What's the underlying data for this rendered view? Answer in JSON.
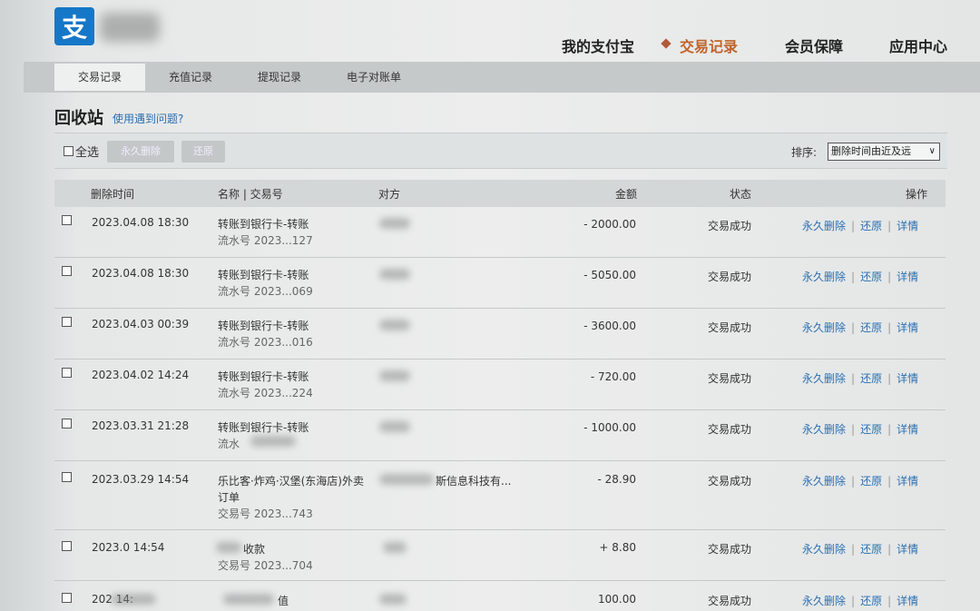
{
  "header": {
    "logo_char": "支",
    "nav": [
      "我的支付宝",
      "交易记录",
      "会员保障",
      "应用中心"
    ]
  },
  "subtabs": [
    "交易记录",
    "充值记录",
    "提现记录",
    "电子对账单"
  ],
  "page": {
    "title": "回收站",
    "help_link": "使用遇到问题?"
  },
  "toolbar": {
    "select_all": "全选",
    "permanent_delete": "永久删除",
    "restore": "还原",
    "sort_label": "排序:",
    "sort_value": "删除时间由近及远"
  },
  "table": {
    "headers": {
      "time": "删除时间",
      "name": "名称 | 交易号",
      "counterparty": "对方",
      "amount": "金额",
      "status": "状态",
      "ops": "操作"
    },
    "ops": [
      "永久删除",
      "还原",
      "详情"
    ],
    "rows": [
      {
        "time": "2023.04.08 18:30",
        "name": "转账到银行卡-转账",
        "name2": "",
        "sub": "流水号 2023...127",
        "party": "",
        "amount": "- 2000.00",
        "status": "交易成功"
      },
      {
        "time": "2023.04.08 18:30",
        "name": "转账到银行卡-转账",
        "name2": "",
        "sub": "流水号 2023...069",
        "party": "",
        "amount": "- 5050.00",
        "status": "交易成功"
      },
      {
        "time": "2023.04.03 00:39",
        "name": "转账到银行卡-转账",
        "name2": "",
        "sub": "流水号 2023...016",
        "party": "",
        "amount": "- 3600.00",
        "status": "交易成功"
      },
      {
        "time": "2023.04.02 14:24",
        "name": "转账到银行卡-转账",
        "name2": "",
        "sub": "流水号 2023...224",
        "party": "",
        "amount": "- 720.00",
        "status": "交易成功"
      },
      {
        "time": "2023.03.31 21:28",
        "name": "转账到银行卡-转账",
        "name2": "",
        "sub": "流水",
        "party": "",
        "amount": "- 1000.00",
        "status": "交易成功"
      },
      {
        "time": "2023.03.29 14:54",
        "name": "乐比客·炸鸡·汉堡(东海店)外卖",
        "name2": "订单",
        "sub": "交易号 2023...743",
        "party": "斯信息科技有...",
        "amount": "- 28.90",
        "status": "交易成功"
      },
      {
        "time": "2023.0 14:54",
        "name": "收款",
        "name2": "",
        "sub": "交易号 2023...704",
        "party": "",
        "amount": "+ 8.80",
        "status": "交易成功"
      },
      {
        "time": "202 14:",
        "name": "值",
        "name2": "",
        "sub": "",
        "party": "",
        "amount": "100.00",
        "status": "交易成功"
      }
    ]
  }
}
